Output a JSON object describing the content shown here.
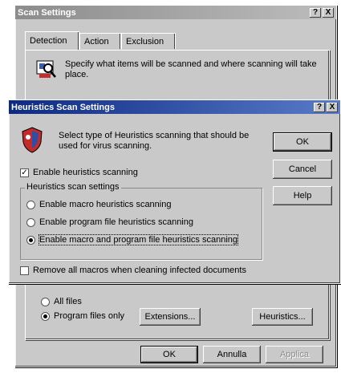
{
  "scan_window": {
    "title": "Scan Settings",
    "help_glyph": "?",
    "close_glyph": "X",
    "tabs": [
      "Detection",
      "Action",
      "Exclusion"
    ],
    "description": "Specify what items will be scanned and where scanning will take place.",
    "file_options": {
      "all_files": "All files",
      "program_files_only": "Program files only",
      "selected": "program_files_only"
    },
    "extensions_button": "Extensions...",
    "heuristics_button": "Heuristics...",
    "ok_button": "OK",
    "annulla_button": "Annulla",
    "applica_button": "Applica"
  },
  "heuristics_dialog": {
    "title": "Heuristics Scan Settings",
    "help_glyph": "?",
    "close_glyph": "X",
    "description": "Select type of Heuristics scanning that should be used for virus scanning.",
    "enable_checkbox": {
      "label": "Enable heuristics scanning",
      "checked": true,
      "check_glyph": "✓"
    },
    "group_label": "Heuristics scan settings",
    "options": [
      {
        "label": "Enable macro heuristics scanning",
        "selected": false
      },
      {
        "label": "Enable program file heuristics scanning",
        "selected": false
      },
      {
        "label": "Enable macro and program file heuristics scanning",
        "selected": true
      }
    ],
    "remove_macros_checkbox": {
      "label": "Remove all macros when cleaning infected documents",
      "checked": false
    },
    "ok_button": "OK",
    "cancel_button": "Cancel",
    "help_button": "Help"
  }
}
